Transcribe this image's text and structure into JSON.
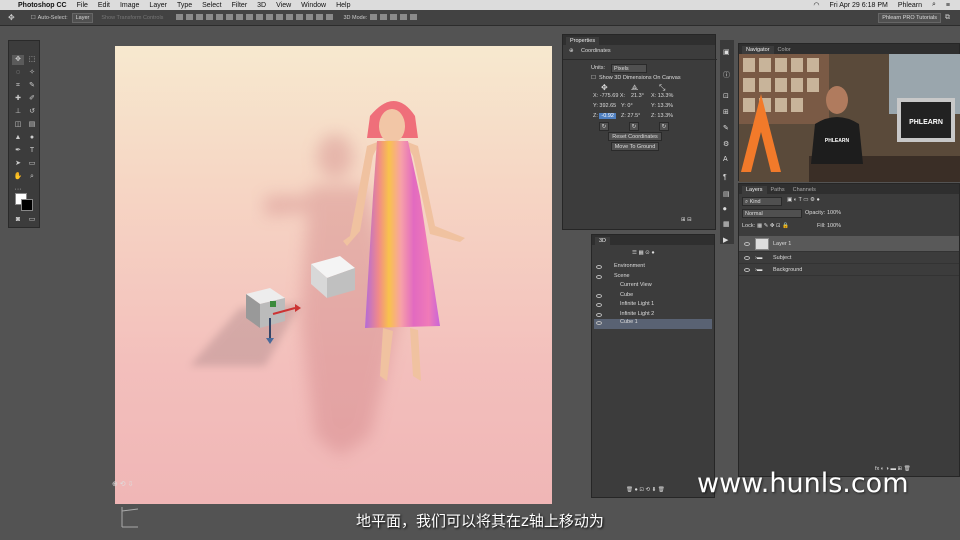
{
  "menubar": {
    "app": "Photoshop CC",
    "items": [
      "File",
      "Edit",
      "Image",
      "Layer",
      "Type",
      "Select",
      "Filter",
      "3D",
      "View",
      "Window",
      "Help"
    ],
    "datetime": "Fri Apr 29  6:18 PM",
    "user": "Phlearn"
  },
  "options": {
    "auto_select": "Auto-Select:",
    "auto_select_value": "Layer",
    "show_transform": "Show Transform Controls",
    "mode_3d": "3D Mode:",
    "workspace": "Phlearn PRO Tutorials"
  },
  "properties": {
    "tab": "Properties",
    "section": "Coordinates",
    "units_label": "Units:",
    "units_value": "Pixels",
    "show_label": "Show 3D Dimensions On Canvas",
    "x_pos": "-775.69 X:",
    "x_rot": "21.3°",
    "x_scale": "13.3%",
    "y_pos": "392.65",
    "y_rot": "0°",
    "y_scale": "13.3%",
    "z_pos": "-0.92",
    "z_rot": "27.5°",
    "z_scale": "13.3%",
    "reset": "Reset Coordinates",
    "move_ground": "Move To Ground"
  },
  "navigator": {
    "tabs": [
      "Navigator",
      "Color"
    ],
    "sign": "PHLEARN",
    "shirt": "PHLEARN"
  },
  "panel3d": {
    "tab": "3D",
    "items": [
      "Environment",
      "Scene",
      "Current View",
      "Cube",
      "Infinite Light 1",
      "Infinite Light 2",
      "Cube 1"
    ]
  },
  "layers": {
    "tabs": [
      "Layers",
      "Paths",
      "Channels"
    ],
    "kind": "Kind",
    "blend": "Normal",
    "opacity_label": "Opacity:",
    "opacity": "100%",
    "lock_label": "Lock:",
    "fill_label": "Fill:",
    "fill": "100%",
    "rows": [
      "Layer 1",
      "Subject",
      "Background"
    ]
  },
  "subtitle": "地平面，我们可以将其在z轴上移动为",
  "watermark": "www.hunls.com",
  "colors": {
    "accent": "#4f7fbf",
    "canvas_top": "#f7e9cf",
    "canvas_bottom": "#f0b6b6"
  }
}
